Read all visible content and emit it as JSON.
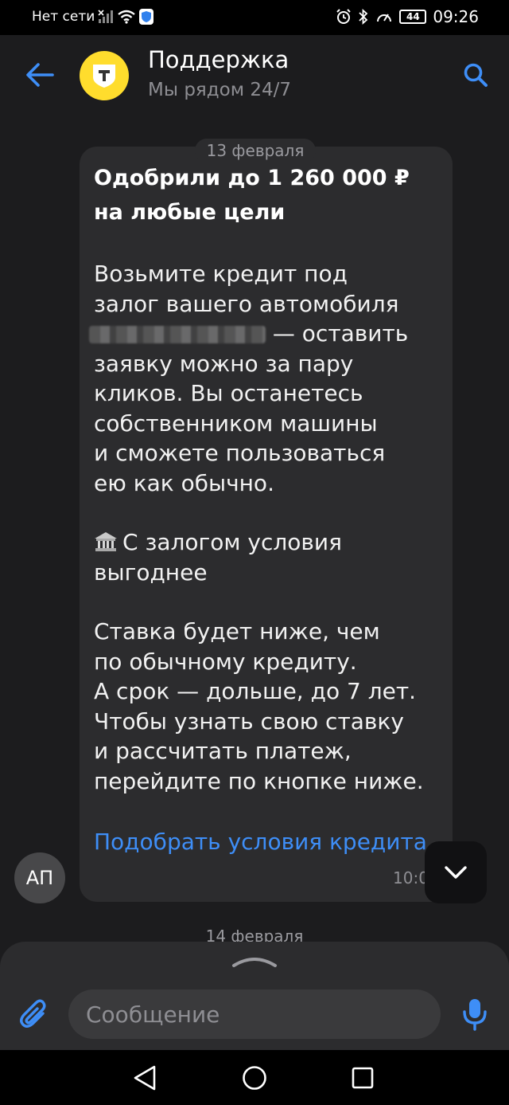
{
  "status_bar": {
    "network": "Нет сети",
    "battery": "44",
    "time": "09:26"
  },
  "header": {
    "title": "Поддержка",
    "subtitle": "Мы рядом 24/7",
    "logo_letter": "Т"
  },
  "chat": {
    "date_1": "13 февраля",
    "date_2": "14 февраля",
    "message": {
      "title": "Одобрили до 1 260 000 ₽\nна любые цели",
      "para1": [
        "Возьмите кредит под",
        "залог вашего автомобиля",
        " — оставить",
        "заявку можно за пару",
        "кликов. Вы останетесь",
        "собственником машины",
        "и сможете пользоваться",
        "ею как обычно."
      ],
      "para2": [
        "С залогом условия",
        "выгоднее"
      ],
      "para3": [
        "Ставка будет ниже, чем",
        "по обычному кредиту.",
        "А срок — дольше, до 7 лет.",
        "Чтобы узнать свою ставку",
        "и рассчитать платеж,",
        "перейдите по кнопке ниже."
      ],
      "link": "Подобрать условия кредита",
      "time": "10:0"
    },
    "user_initials": "АП"
  },
  "composer": {
    "placeholder": "Сообщение"
  },
  "icons": {
    "back": "arrow-left-icon",
    "search": "search-icon",
    "attach": "paperclip-icon",
    "mic": "microphone-icon",
    "scroll": "chevron-down-icon",
    "bank": "bank-icon"
  },
  "colors": {
    "accent": "#3e8ef7",
    "brand_yellow": "#ffdd2d",
    "background": "#1c1c1e",
    "bubble": "#2c2c2e"
  }
}
